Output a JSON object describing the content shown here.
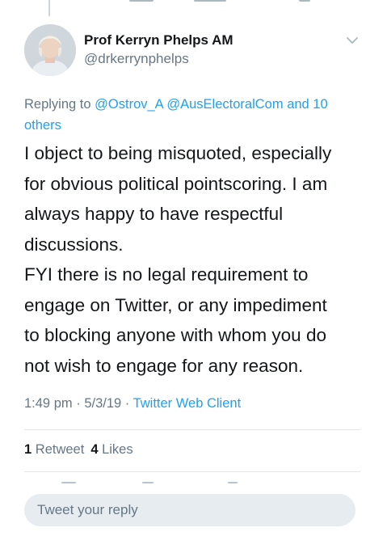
{
  "tweet": {
    "author_name": "Prof Kerryn Phelps AM",
    "author_handle": "@drkerrynphelps",
    "replying_prefix": "Replying to",
    "replying_to": [
      "@Ostrov_A",
      "@AusElectoralCom"
    ],
    "replying_more": "and 10 others",
    "body_lines": [
      "I object to being misquoted, especially",
      "for obvious political pointscoring. I am",
      "always happy to have respectful",
      "discussions.",
      "FYI there is no legal requirement to",
      "engage on Twitter, or any impediment",
      "to blocking anyone with whom you do",
      "not wish to engage for any reason."
    ],
    "time": "1:49 pm",
    "date": "5/3/19",
    "separator": "·",
    "client": "Twitter Web Client",
    "retweet_count": "1",
    "retweet_label": "Retweet",
    "like_count": "4",
    "like_label": "Likes"
  },
  "reply_box": {
    "placeholder": "Tweet your reply"
  },
  "icons": {
    "caret": "chevron-down-icon",
    "avatar": "avatar-photo"
  },
  "colors": {
    "link": "#1da1f2",
    "secondary_text": "#657786",
    "primary_text": "#14171a",
    "divider": "#e1e8ed",
    "reply_box_bg": "#e6ecf0"
  }
}
